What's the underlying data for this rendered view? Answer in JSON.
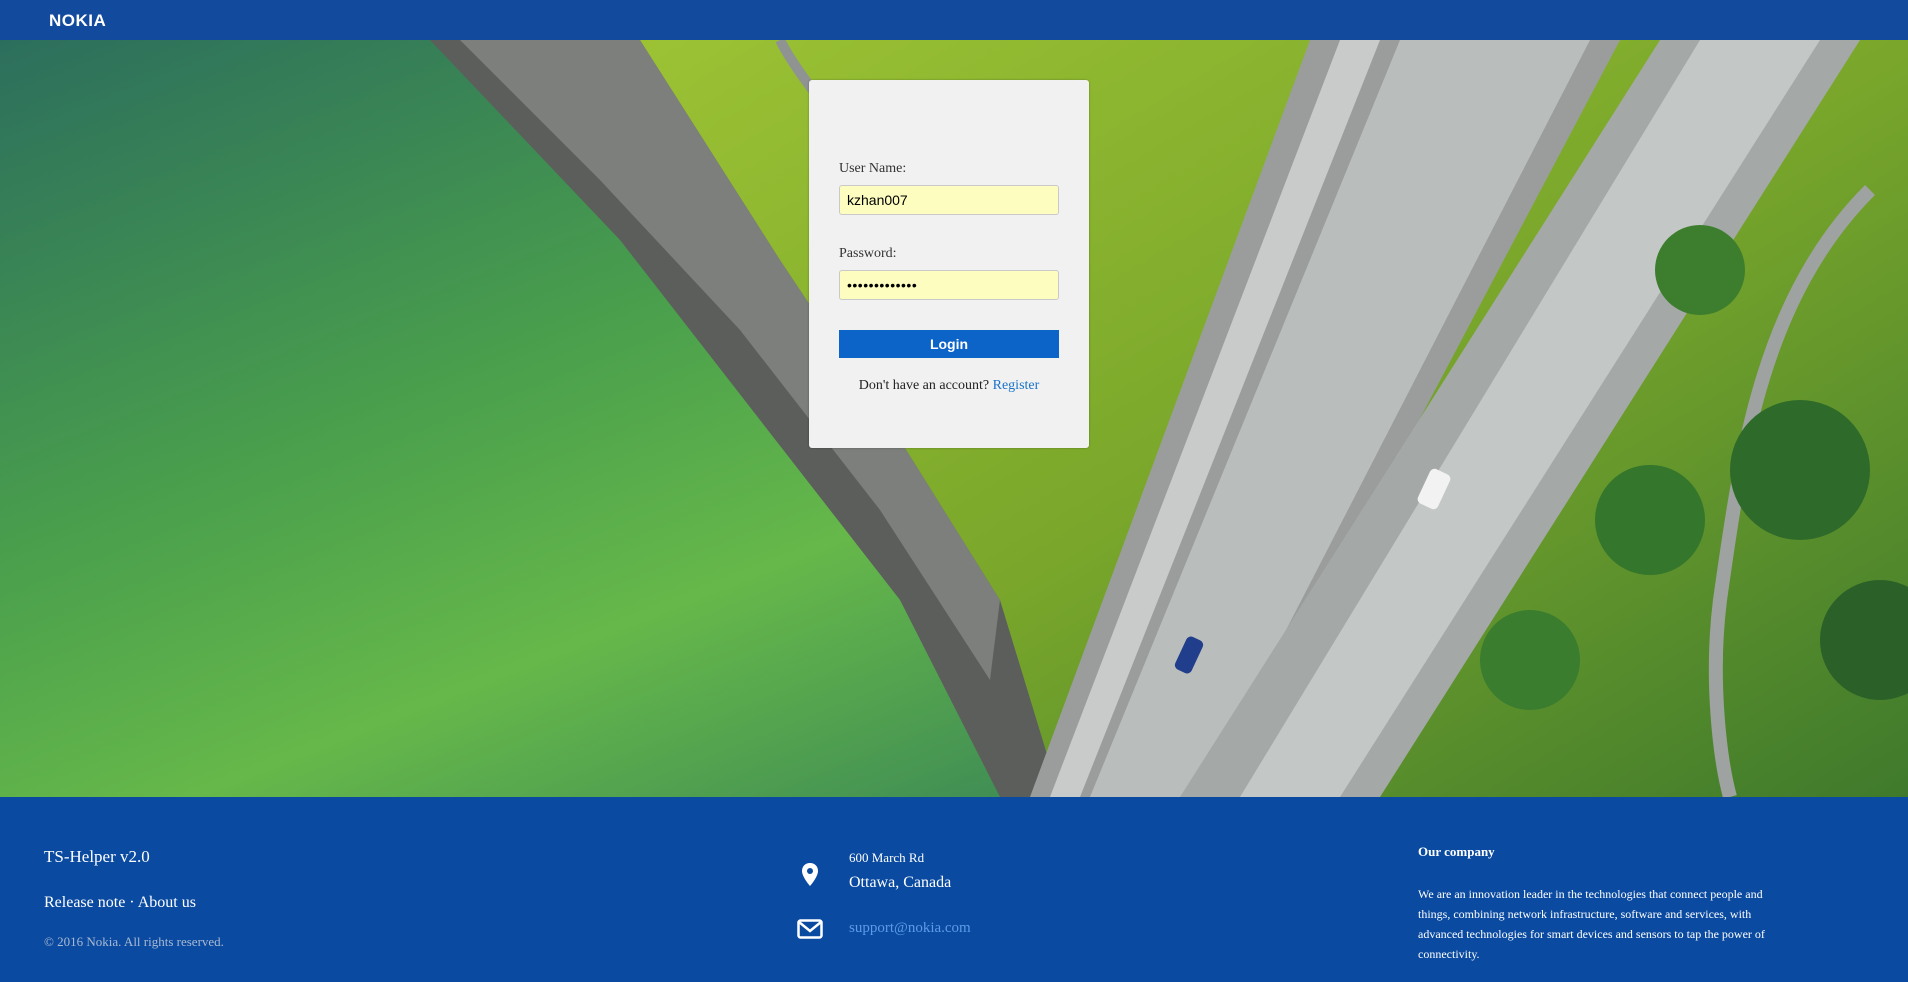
{
  "header": {
    "logo_text": "NOKIA",
    "bg_color": "#124a9e"
  },
  "login": {
    "username_label": "User Name:",
    "username_value": "kzhan007",
    "password_label": "Password:",
    "password_value": "•••••••••••••",
    "login_label": "Login",
    "signup_text": "Don't have an account?",
    "register_label": "Register",
    "accent_color": "#0c63c8"
  },
  "footer": {
    "app_title": "TS-Helper v2.0",
    "release_note_label": "Release note",
    "separator": "·",
    "about_label": "About us",
    "copyright": "© 2016 Nokia. All rights reserved.",
    "address_line1": "600 March Rd",
    "address_line2": "Ottawa, Canada",
    "email": "support@nokia.com",
    "company_heading": "Our company",
    "company_text": "We are an innovation leader in the technologies that connect people and things, combining network infrastructure, software and services, with advanced technologies for smart devices and sensors to tap the power of connectivity.",
    "location_icon": "map-pin-icon",
    "email_icon": "envelope-icon"
  }
}
